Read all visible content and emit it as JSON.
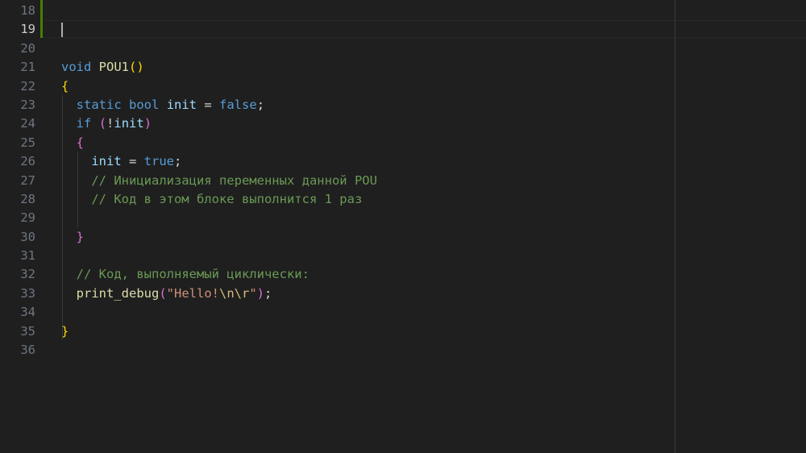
{
  "editor": {
    "lines": [
      {
        "no": "18",
        "tokens": []
      },
      {
        "no": "19",
        "active": true,
        "tokens": []
      },
      {
        "no": "20",
        "tokens": []
      },
      {
        "no": "21",
        "tokens": [
          {
            "t": "void",
            "c": "kw"
          },
          {
            "t": " "
          },
          {
            "t": "POU1",
            "c": "fn"
          },
          {
            "t": "()",
            "c": "brk1"
          }
        ]
      },
      {
        "no": "22",
        "tokens": [
          {
            "t": "{",
            "c": "brk1"
          }
        ]
      },
      {
        "no": "23",
        "tokens": [
          {
            "t": "  "
          },
          {
            "t": "static",
            "c": "kw"
          },
          {
            "t": " "
          },
          {
            "t": "bool",
            "c": "kw"
          },
          {
            "t": " "
          },
          {
            "t": "init",
            "c": "var"
          },
          {
            "t": " = ",
            "c": "op"
          },
          {
            "t": "false",
            "c": "kw"
          },
          {
            "t": ";",
            "c": "op"
          }
        ]
      },
      {
        "no": "24",
        "tokens": [
          {
            "t": "  "
          },
          {
            "t": "if",
            "c": "kw"
          },
          {
            "t": " "
          },
          {
            "t": "(",
            "c": "brk2"
          },
          {
            "t": "!",
            "c": "op"
          },
          {
            "t": "init",
            "c": "var"
          },
          {
            "t": ")",
            "c": "brk2"
          }
        ]
      },
      {
        "no": "25",
        "tokens": [
          {
            "t": "  "
          },
          {
            "t": "{",
            "c": "brk2"
          }
        ]
      },
      {
        "no": "26",
        "tokens": [
          {
            "t": "    "
          },
          {
            "t": "init",
            "c": "var"
          },
          {
            "t": " = ",
            "c": "op"
          },
          {
            "t": "true",
            "c": "kw"
          },
          {
            "t": ";",
            "c": "op"
          }
        ]
      },
      {
        "no": "27",
        "tokens": [
          {
            "t": "    "
          },
          {
            "t": "// Инициализация переменных данной POU",
            "c": "cmt"
          }
        ]
      },
      {
        "no": "28",
        "tokens": [
          {
            "t": "    "
          },
          {
            "t": "// Код в этом блоке выполнится 1 раз",
            "c": "cmt"
          }
        ]
      },
      {
        "no": "29",
        "tokens": []
      },
      {
        "no": "30",
        "tokens": [
          {
            "t": "  "
          },
          {
            "t": "}",
            "c": "brk2"
          }
        ]
      },
      {
        "no": "31",
        "tokens": []
      },
      {
        "no": "32",
        "tokens": [
          {
            "t": "  "
          },
          {
            "t": "// Код, выполняемый циклически:",
            "c": "cmt"
          }
        ]
      },
      {
        "no": "33",
        "tokens": [
          {
            "t": "  "
          },
          {
            "t": "print_debug",
            "c": "fn"
          },
          {
            "t": "(",
            "c": "brk2"
          },
          {
            "t": "\"Hello!",
            "c": "str"
          },
          {
            "t": "\\n\\r",
            "c": "esc"
          },
          {
            "t": "\"",
            "c": "str"
          },
          {
            "t": ")",
            "c": "brk2"
          },
          {
            "t": ";",
            "c": "op"
          }
        ]
      },
      {
        "no": "34",
        "tokens": []
      },
      {
        "no": "35",
        "tokens": [
          {
            "t": "}",
            "c": "brk1"
          }
        ]
      },
      {
        "no": "36",
        "tokens": []
      }
    ]
  },
  "colors": {
    "background": "#1f1f1f",
    "git_added": "#487e02",
    "keyword": "#569cd6",
    "function": "#dcdcaa",
    "variable": "#9cdcfe",
    "comment": "#6a9955",
    "string": "#ce9178"
  }
}
